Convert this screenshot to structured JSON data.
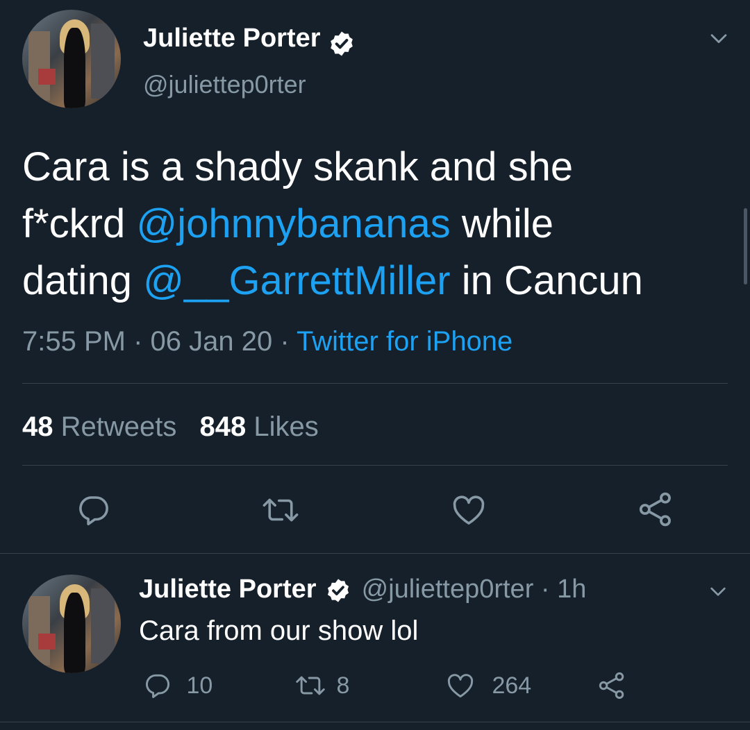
{
  "main_tweet": {
    "display_name": "Juliette Porter",
    "handle": "@juliettep0rter",
    "text_part1": "Cara is a shady skank and she",
    "text_part2": "f*ckrd ",
    "mention1": "@johnnybananas",
    "text_part3": " while",
    "text_part4": "dating ",
    "mention2": "@__GarrettMiller",
    "text_part5": " in Cancun",
    "time": "7:55 PM",
    "separator1": " · ",
    "date": "06 Jan 20",
    "separator2": " · ",
    "source": "Twitter for iPhone",
    "retweets_count": "48",
    "retweets_label": "Retweets",
    "likes_count": "848",
    "likes_label": "Likes",
    "actions": [
      "reply-icon",
      "retweet-icon",
      "like-icon",
      "share-icon"
    ]
  },
  "reply_tweet": {
    "display_name": "Juliette Porter",
    "handle": "@juliettep0rter",
    "separator": " · ",
    "time_ago": "1h",
    "text": "Cara from our show lol",
    "reply_count": "10",
    "retweet_count": "8",
    "like_count": "264"
  },
  "colors": {
    "background": "#15202b",
    "text": "#ffffff",
    "muted": "#8899a6",
    "link": "#1da1f2",
    "divider": "#38444d"
  }
}
